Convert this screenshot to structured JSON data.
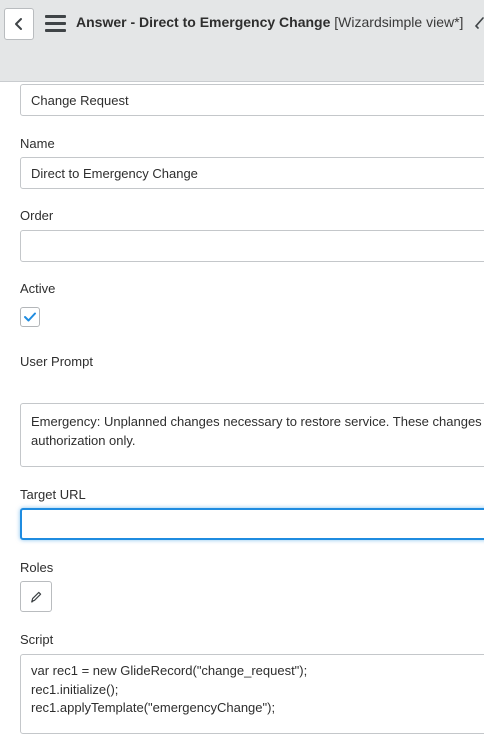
{
  "header": {
    "title": "Answer - Direct to Emergency Change",
    "view": "[Wizardsimple view*]",
    "background": "#e4e6e7"
  },
  "form": {
    "top_field_value": "Change Request",
    "name_label": "Name",
    "name_value": "Direct to Emergency Change",
    "order_label": "Order",
    "order_value": "",
    "active_label": "Active",
    "active_checked": true,
    "user_prompt_label": "User Prompt",
    "user_prompt_value": "Emergency: Unplanned changes necessary to restore service. These changes require\nauthorization only.",
    "target_url_label": "Target URL",
    "target_url_value": "",
    "roles_label": "Roles",
    "script_label": "Script",
    "script_value": "var rec1 = new GlideRecord(\"change_request\");\nrec1.initialize();\nrec1.applyTemplate(\"emergencyChange\");"
  },
  "colors": {
    "focus_blue": "#1f8ce0",
    "check_blue": "#1f8ce0"
  },
  "icons": {
    "back": "chevron-left-icon",
    "menu": "hamburger-icon",
    "roles_edit": "pencil-icon",
    "checkbox": "checkmark-icon"
  }
}
